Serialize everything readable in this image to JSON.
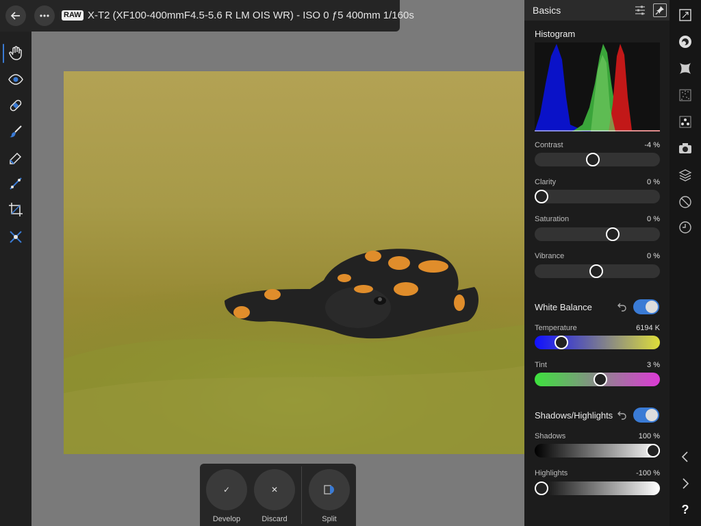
{
  "top_bar": {
    "back_icon": "arrow-left-icon",
    "more_icon": "more-icon",
    "raw_badge": "RAW",
    "camera_info": "X-T2 (XF100-400mmF4.5-5.6 R LM OIS WR) - ISO 0 ƒ5 400mm 1/160s"
  },
  "tools": [
    "hand-icon",
    "eye-icon",
    "bandage-icon",
    "brush-icon",
    "eraser-icon",
    "gradient-icon",
    "crop-icon",
    "overlay-icon"
  ],
  "develop_toolbar": {
    "develop_label": "Develop",
    "discard_label": "Discard",
    "split_label": "Split",
    "develop_glyph": "✓",
    "discard_glyph": "✕"
  },
  "panel": {
    "title": "Basics",
    "histogram_title": "Histogram",
    "contrast": {
      "label": "Contrast",
      "value": "-4 %",
      "position": 0.46
    },
    "clarity": {
      "label": "Clarity",
      "value": "0 %",
      "position": 0.0
    },
    "saturation": {
      "label": "Saturation",
      "value": "0 %",
      "position": 0.64
    },
    "vibrance": {
      "label": "Vibrance",
      "value": "0 %",
      "position": 0.49
    },
    "white_balance": {
      "title": "White Balance",
      "enabled": true
    },
    "temperature": {
      "label": "Temperature",
      "value": "6194 K",
      "position": 0.18
    },
    "tint": {
      "label": "Tint",
      "value": "3 %",
      "position": 0.53
    },
    "shadows_highlights": {
      "title": "Shadows/Highlights",
      "enabled": true
    },
    "shadows": {
      "label": "Shadows",
      "value": "100 %",
      "position": 1.0
    },
    "highlights": {
      "label": "Highlights",
      "value": "-100 %",
      "position": 0.0
    }
  },
  "studio_icons": [
    "navigator-icon",
    "color-icon",
    "vignette-icon",
    "noise-icon",
    "detail-icon",
    "lens-icon",
    "layers-icon",
    "no-entry-icon",
    "history-icon",
    "chevron-left-icon",
    "chevron-right-icon",
    "help-icon"
  ],
  "help_glyph": "?",
  "colors": {
    "accent": "#3a7bd5",
    "panel_bg": "#1c1c1c",
    "toolbar_bg": "#202020"
  }
}
